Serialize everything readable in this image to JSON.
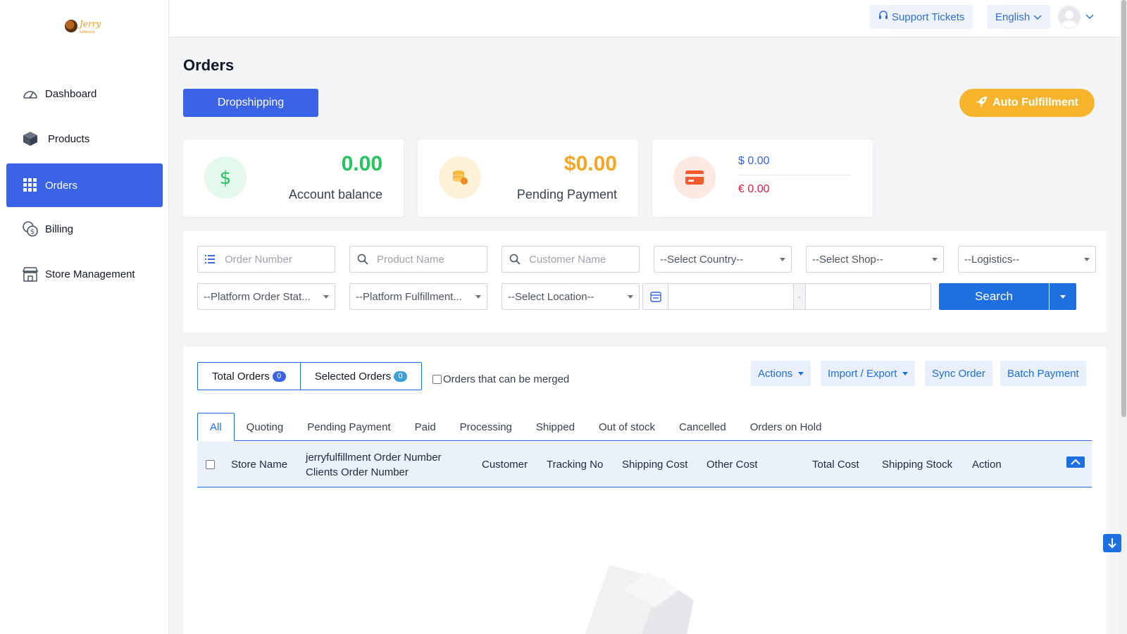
{
  "sidebar": {
    "logo": {
      "text": "Jerry",
      "sub": "fulfillment"
    },
    "items": [
      {
        "label": "Dashboard",
        "icon": "dashboard-gauge-icon",
        "active": false
      },
      {
        "label": "Products",
        "icon": "box-icon",
        "active": false
      },
      {
        "label": "Orders",
        "icon": "grid-icon",
        "active": true
      },
      {
        "label": "Billing",
        "icon": "coins-icon",
        "active": false
      },
      {
        "label": "Store Management",
        "icon": "store-icon",
        "active": false
      }
    ]
  },
  "topbar": {
    "support_label": "Support Tickets",
    "language_label": "English"
  },
  "page": {
    "title": "Orders",
    "dropshipping_label": "Dropshipping",
    "auto_fulfillment_label": "Auto Fulfillment"
  },
  "stats": {
    "account_balance": {
      "value": "0.00",
      "label": "Account balance"
    },
    "pending_payment": {
      "value": "$0.00",
      "label": "Pending Payment"
    },
    "currency": {
      "usd": "$ 0.00",
      "eur": "€ 0.00"
    }
  },
  "filters": {
    "order_number_placeholder": "Order Number",
    "product_name_placeholder": "Product Name",
    "customer_name_placeholder": "Customer Name",
    "country_select": "--Select Country--",
    "shop_select": "--Select Shop--",
    "logistics_select": "--Logistics--",
    "platform_order_status": "--Platform Order Stat...",
    "platform_fulfillment": "--Platform Fulfillment...",
    "location_select": "--Select Location--",
    "date_separator": "-",
    "search_label": "Search"
  },
  "orders": {
    "total_label": "Total Orders",
    "total_count": "0",
    "selected_label": "Selected Orders",
    "selected_count": "0",
    "merge_label": "Orders that can be merged",
    "actions_label": "Actions",
    "import_export_label": "Import / Export",
    "sync_label": "Sync Order",
    "batch_payment_label": "Batch Payment",
    "tabs": [
      "All",
      "Quoting",
      "Pending Payment",
      "Paid",
      "Processing",
      "Shipped",
      "Out of stock",
      "Cancelled",
      "Orders on Hold"
    ],
    "columns": {
      "store_name": "Store Name",
      "order_number_1": "jerryfulfillment Order Number",
      "order_number_2": "Clients Order Number",
      "customer": "Customer",
      "tracking": "Tracking No",
      "shipping_cost": "Shipping Cost",
      "other_cost": "Other Cost",
      "total_cost": "Total Cost",
      "shipping_stock": "Shipping Stock",
      "action": "Action"
    }
  },
  "colors": {
    "primary": "#1e6fe0",
    "nav_active": "#3a63e6",
    "green": "#22c55e",
    "orange": "#f5a623",
    "blue_badge": "#3a63e6",
    "teal_badge": "#3aa0d8",
    "red": "#e11d48"
  }
}
